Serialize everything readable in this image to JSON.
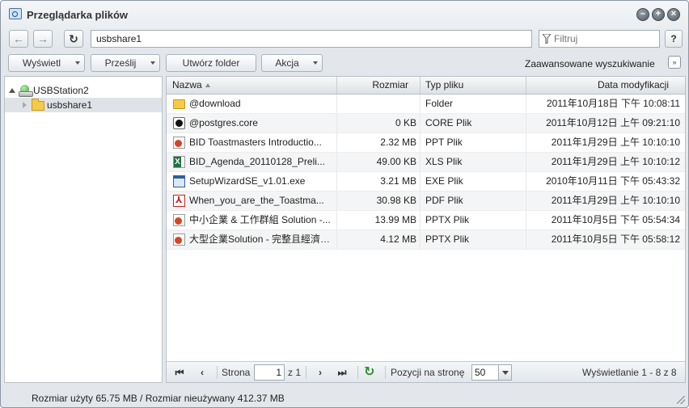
{
  "window": {
    "title": "Przeglądarka plików"
  },
  "toolbar": {
    "back_label": "←",
    "forward_label": "→",
    "refresh_label": "↻",
    "address": "usbshare1",
    "filter_placeholder": "Filtruj",
    "help_label": "?",
    "view_label": "Wyświetl",
    "upload_label": "Prześlij",
    "create_folder_label": "Utwórz folder",
    "action_label": "Akcja",
    "advanced_search_label": "Zaawansowane wyszukiwanie",
    "advanced_toggle": "»"
  },
  "tree": {
    "root": "USBStation2",
    "child": "usbshare1"
  },
  "grid": {
    "columns": [
      "Nazwa",
      "Rozmiar",
      "Typ pliku",
      "Data modyfikacji"
    ],
    "rows": [
      {
        "name": "@download",
        "size": "",
        "type": "Folder",
        "date": "2011年10月18日 下午 10:08:11",
        "icon": "folder-icon"
      },
      {
        "name": "@postgres.core",
        "size": "0 KB",
        "type": "CORE Plik",
        "date": "2011年10月12日 上午 09:21:10",
        "icon": "core-file-icon"
      },
      {
        "name": "BID Toastmasters Introductio...",
        "size": "2.32 MB",
        "type": "PPT Plik",
        "date": "2011年1月29日 上午 10:10:10",
        "icon": "ppt-file-icon"
      },
      {
        "name": "BID_Agenda_20110128_Preli...",
        "size": "49.00 KB",
        "type": "XLS Plik",
        "date": "2011年1月29日 上午 10:10:12",
        "icon": "xls-file-icon"
      },
      {
        "name": "SetupWizardSE_v1.01.exe",
        "size": "3.21 MB",
        "type": "EXE Plik",
        "date": "2010年10月11日 下午 05:43:32",
        "icon": "exe-file-icon"
      },
      {
        "name": "When_you_are_the_Toastma...",
        "size": "30.98 KB",
        "type": "PDF Plik",
        "date": "2011年1月29日 上午 10:10:10",
        "icon": "pdf-file-icon"
      },
      {
        "name": "中小企業 & 工作群組 Solution -...",
        "size": "13.99 MB",
        "type": "PPTX Plik",
        "date": "2011年10月5日 下午 05:54:34",
        "icon": "pptx-file-icon"
      },
      {
        "name": "大型企業Solution - 完整且經濟實...",
        "size": "4.12 MB",
        "type": "PPTX Plik",
        "date": "2011年10月5日 下午 05:58:12",
        "icon": "pptx-file-icon"
      }
    ]
  },
  "pager": {
    "page_label": "Strona",
    "page_value": "1",
    "of_label": "z 1",
    "per_page_label": "Pozycji na stronę",
    "per_page_value": "50",
    "displaying": "Wyświetlanie 1 - 8 z 8"
  },
  "status": {
    "text": "Rozmiar użyty 65.75 MB / Rozmiar nieużywany 412.37 MB"
  }
}
